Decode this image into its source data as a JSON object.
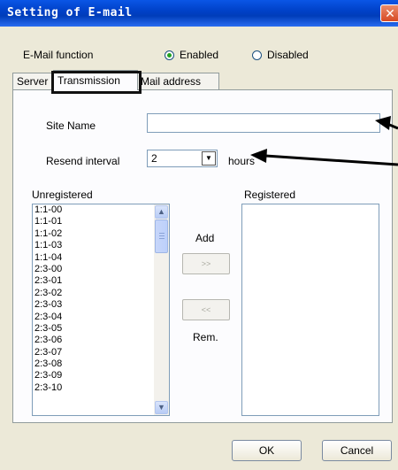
{
  "window": {
    "title": "Setting of E-mail",
    "close_icon": "close-icon",
    "close_glyph": "✕",
    "title_bar_color": "#0a56e6"
  },
  "email_function": {
    "label": "E-Mail function",
    "enabled_label": "Enabled",
    "disabled_label": "Disabled",
    "selected": "Enabled"
  },
  "tabs": [
    {
      "label": "Server",
      "active": false
    },
    {
      "label": "Transmission",
      "active": true
    },
    {
      "label": "Mail address",
      "active": false
    }
  ],
  "transmission": {
    "site_name_label": "Site Name",
    "site_name_value": "",
    "resend_interval_label": "Resend interval",
    "resend_interval_value": "2",
    "resend_unit": "hours"
  },
  "unregistered": {
    "label": "Unregistered",
    "items": [
      "1:1-00",
      "1:1-01",
      "1:1-02",
      "1:1-03",
      "1:1-04",
      "2:3-00",
      "2:3-01",
      "2:3-02",
      "2:3-03",
      "2:3-04",
      "2:3-05",
      "2:3-06",
      "2:3-07",
      "2:3-08",
      "2:3-09",
      "2:3-10"
    ]
  },
  "registered": {
    "label": "Registered",
    "items": []
  },
  "transfer": {
    "add_label": "Add",
    "add_button": ">>",
    "remove_button": "<<",
    "remove_label": "Rem."
  },
  "footer": {
    "ok_label": "OK",
    "cancel_label": "Cancel"
  },
  "scrollbar": {
    "up_glyph": "▲",
    "down_glyph": "▼"
  },
  "select": {
    "dropdown_glyph": "▼"
  }
}
